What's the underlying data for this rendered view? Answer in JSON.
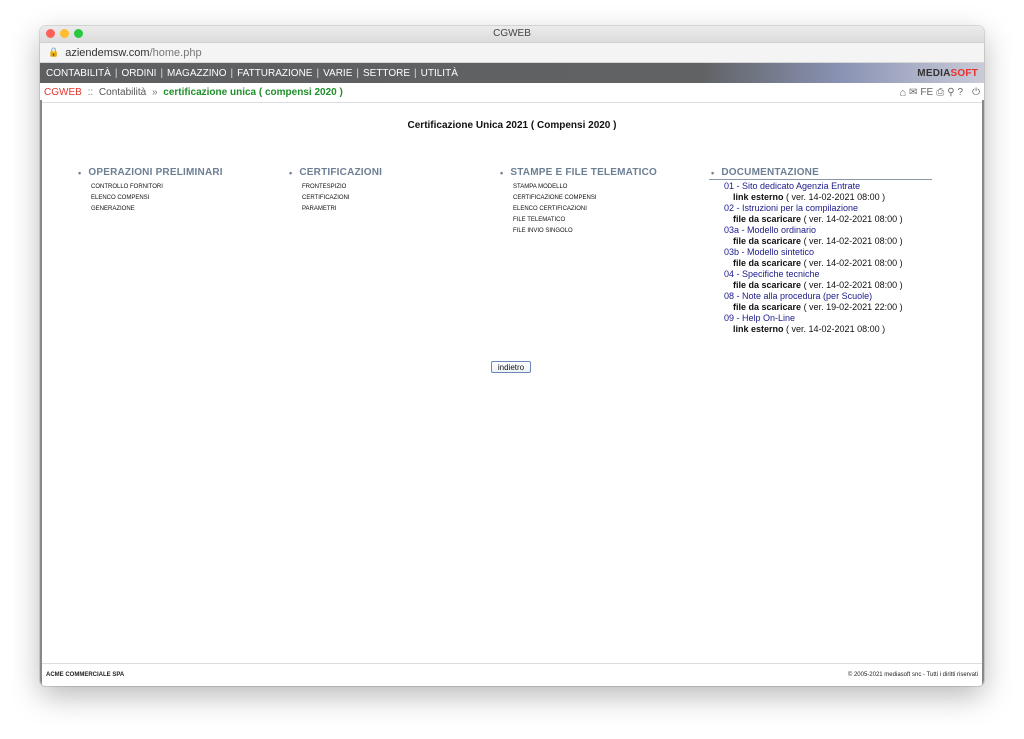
{
  "window": {
    "title": "CGWEB"
  },
  "urlbar": {
    "host": "aziendemsw.com",
    "path": "/home.php"
  },
  "menubar": {
    "items": [
      "CONTABILITÀ",
      "ORDINI",
      "MAGAZZINO",
      "FATTURAZIONE",
      "VARIE",
      "SETTORE",
      "UTILITÀ"
    ],
    "separator": "|",
    "brand_part1": "MEDIA",
    "brand_part2": "SOFT"
  },
  "breadcrumb": {
    "app": "CGWEB",
    "sep1": "::",
    "section": "Contabilità",
    "sep2": "»",
    "current": "certificazione unica ( compensi 2020 )"
  },
  "toolbar": {
    "fe_label": "FE",
    "help_label": "?"
  },
  "page": {
    "title": "Certificazione Unica 2021 ( Compensi 2020 )"
  },
  "columns": [
    {
      "heading": "OPERAZIONI PRELIMINARI",
      "items": [
        "Controllo fornitori",
        "Elenco compensi",
        "Generazione"
      ]
    },
    {
      "heading": "CERTIFICAZIONI",
      "items": [
        "Frontespizio",
        "Certificazioni",
        "Parametri"
      ]
    },
    {
      "heading": "STAMPE E FILE TELEMATICO",
      "items": [
        "Stampa modello",
        "Certificazione compensi",
        "Elenco certificazioni",
        "File telematico",
        "File invio singolo"
      ]
    },
    {
      "heading": "DOCUMENTAZIONE"
    }
  ],
  "documents": [
    {
      "title": "01 - Sito dedicato Agenzia Entrate",
      "kind": "link esterno",
      "version": "( ver. 14-02-2021 08:00 )"
    },
    {
      "title": "02 - Istruzioni per la compilazione",
      "kind": "file da scaricare",
      "version": "( ver. 14-02-2021 08:00 )"
    },
    {
      "title": "03a - Modello ordinario",
      "kind": "file da scaricare",
      "version": "( ver. 14-02-2021 08:00 )"
    },
    {
      "title": "03b - Modello sintetico",
      "kind": "file da scaricare",
      "version": "( ver. 14-02-2021 08:00 )"
    },
    {
      "title": "04 - Specifiche tecniche",
      "kind": "file da scaricare",
      "version": "( ver. 14-02-2021 08:00 )"
    },
    {
      "title": "08 - Note alla procedura (per Scuole)",
      "kind": "file da scaricare",
      "version": "( ver. 19-02-2021 22:00 )"
    },
    {
      "title": "09 - Help On-Line",
      "kind": "link esterno",
      "version": "( ver. 14-02-2021 08:00 )"
    }
  ],
  "back_button": {
    "label": "indietro"
  },
  "footer": {
    "company": "ACME COMMERCIALE SPA",
    "copyright": "© 2005-2021 mediasoft snc - Tutti i diritti riservati"
  }
}
